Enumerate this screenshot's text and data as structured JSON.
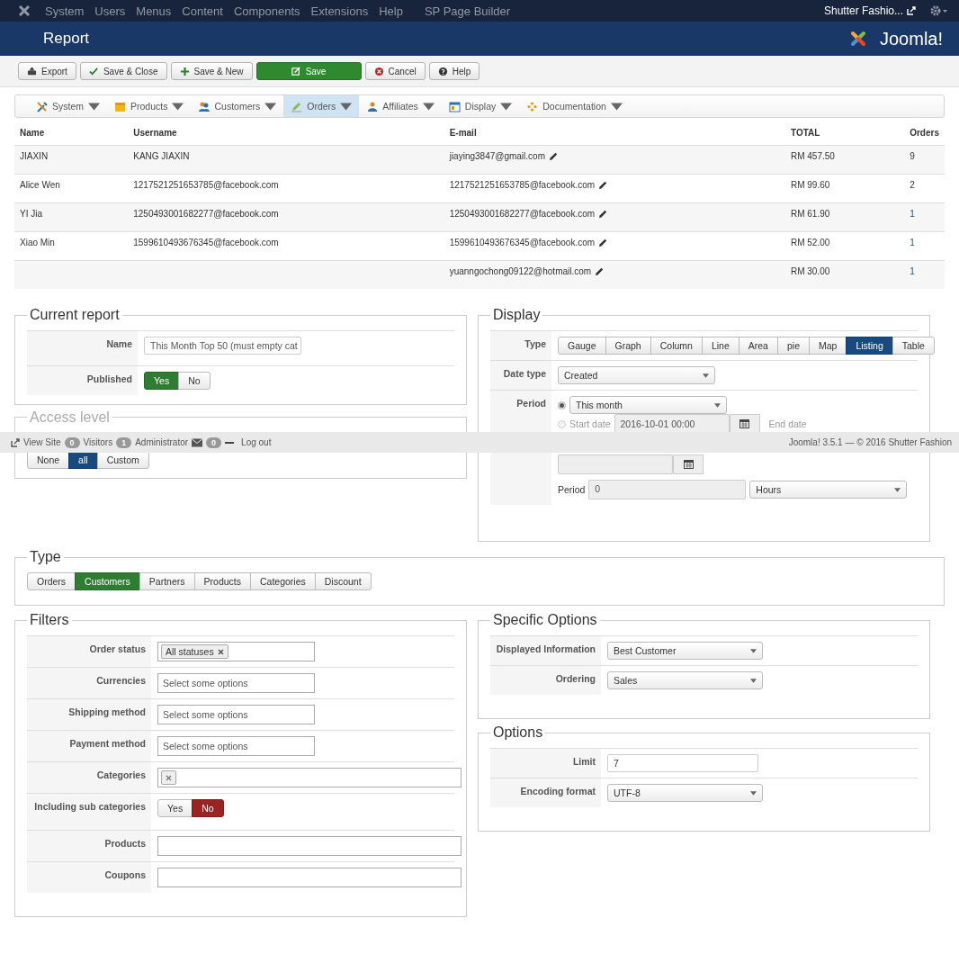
{
  "admin_menu": {
    "items": [
      "System",
      "Users",
      "Menus",
      "Content",
      "Components",
      "Extensions",
      "Help",
      "SP Page Builder"
    ],
    "site_link": "Shutter Fashio..."
  },
  "header": {
    "title": "Report",
    "logo_text": "Joomla!"
  },
  "toolbar": [
    {
      "label": "Export",
      "kind": "export"
    },
    {
      "label": "Save & Close",
      "kind": "check"
    },
    {
      "label": "Save & New",
      "kind": "plus"
    },
    {
      "label": "Save",
      "kind": "save"
    },
    {
      "label": "Cancel",
      "kind": "cancel"
    },
    {
      "label": "Help",
      "kind": "help"
    }
  ],
  "submenu": [
    {
      "label": "System",
      "selected": false
    },
    {
      "label": "Products",
      "selected": false
    },
    {
      "label": "Customers",
      "selected": false
    },
    {
      "label": "Orders",
      "selected": true
    },
    {
      "label": "Affiliates",
      "selected": false
    },
    {
      "label": "Display",
      "selected": false
    },
    {
      "label": "Documentation",
      "selected": false
    }
  ],
  "table": {
    "columns": [
      "Name",
      "Username",
      "E-mail",
      "TOTAL",
      "Orders"
    ],
    "rows": [
      {
        "name": "JIAXIN",
        "username": "KANG JIAXIN",
        "email": "jiaying3847@gmail.com",
        "total": "RM 457.50",
        "orders": "9",
        "orders_link": false
      },
      {
        "name": "Alice Wen",
        "username": "1217521251653785@facebook.com",
        "email": "1217521251653785@facebook.com",
        "total": "RM 99.60",
        "orders": "2",
        "orders_link": false
      },
      {
        "name": "YI Jia",
        "username": "1250493001682277@facebook.com",
        "email": "1250493001682277@facebook.com",
        "total": "RM 61.90",
        "orders": "1",
        "orders_link": true
      },
      {
        "name": "Xiao Min",
        "username": "1599610493676345@facebook.com",
        "email": "1599610493676345@facebook.com",
        "total": "RM 52.00",
        "orders": "1",
        "orders_link": true
      },
      {
        "name": "",
        "username": "",
        "email": "yuanngochong09122@hotmail.com",
        "total": "RM 30.00",
        "orders": "1",
        "orders_link": true
      }
    ]
  },
  "current_report": {
    "legend": "Current report",
    "name_label": "Name",
    "name_value": "This Month Top 50 (must empty cat",
    "published_label": "Published",
    "published_options": [
      {
        "label": "Yes",
        "selected": true
      },
      {
        "label": "No",
        "selected": false
      }
    ]
  },
  "access_level": {
    "legend": "Access level",
    "options": [
      {
        "label": "None",
        "selected": false
      },
      {
        "label": "all",
        "selected": true
      },
      {
        "label": "Custom",
        "selected": false
      }
    ]
  },
  "display": {
    "legend": "Display",
    "type_label": "Type",
    "types": [
      {
        "label": "Gauge",
        "selected": false
      },
      {
        "label": "Graph",
        "selected": false
      },
      {
        "label": "Column",
        "selected": false
      },
      {
        "label": "Line",
        "selected": false
      },
      {
        "label": "Area",
        "selected": false
      },
      {
        "label": "pie",
        "selected": false
      },
      {
        "label": "Map",
        "selected": false
      },
      {
        "label": "Listing",
        "selected": true
      },
      {
        "label": "Table",
        "selected": false
      }
    ],
    "date_type_label": "Date type",
    "date_type": "Created",
    "period_label": "Period",
    "period_preset": {
      "value": "This month",
      "selected": true
    },
    "period_range": {
      "start_label": "Start date",
      "start_value": "2016-10-01 00:00",
      "end_label": "End date",
      "selected": false
    },
    "period_count_label": "Period",
    "period_count": "0",
    "period_unit": "Hours"
  },
  "type": {
    "legend": "Type",
    "options": [
      {
        "label": "Orders",
        "selected": false
      },
      {
        "label": "Customers",
        "selected": true
      },
      {
        "label": "Partners",
        "selected": false
      },
      {
        "label": "Products",
        "selected": false
      },
      {
        "label": "Categories",
        "selected": false
      },
      {
        "label": "Discount",
        "selected": false
      }
    ]
  },
  "filters": {
    "legend": "Filters",
    "rows": [
      {
        "label": "Order status",
        "kind": "tags",
        "tags": [
          "All statuses"
        ]
      },
      {
        "label": "Currencies",
        "kind": "multi",
        "placeholder": "Select some options"
      },
      {
        "label": "Shipping method",
        "kind": "multi",
        "placeholder": "Select some options"
      },
      {
        "label": "Payment method",
        "kind": "multi",
        "placeholder": "Select some options"
      },
      {
        "label": "Categories",
        "kind": "emptytag"
      },
      {
        "label": "Including sub categories",
        "kind": "toggle",
        "options": [
          {
            "label": "Yes",
            "selected": false
          },
          {
            "label": "No",
            "selected": true
          }
        ]
      },
      {
        "label": "Products",
        "kind": "wide"
      },
      {
        "label": "Coupons",
        "kind": "wide"
      }
    ]
  },
  "specific_options": {
    "legend": "Specific Options",
    "rows": [
      {
        "label": "Displayed Information",
        "kind": "select",
        "value": "Best Customer"
      },
      {
        "label": "Ordering",
        "kind": "select",
        "value": "Sales"
      }
    ]
  },
  "options": {
    "legend": "Options",
    "rows": [
      {
        "label": "Limit",
        "kind": "input",
        "value": "7"
      },
      {
        "label": "Encoding format",
        "kind": "select",
        "value": "UTF-8"
      }
    ]
  },
  "status_bar": {
    "view_site": "View Site",
    "visitors_count": "0",
    "visitors_label": "Visitors",
    "admins_count": "1",
    "admins_label": "Administrator",
    "messages_count": "0",
    "logout": "Log out",
    "version": "Joomla! 3.5.1  —  © 2016 Shutter Fashion"
  }
}
